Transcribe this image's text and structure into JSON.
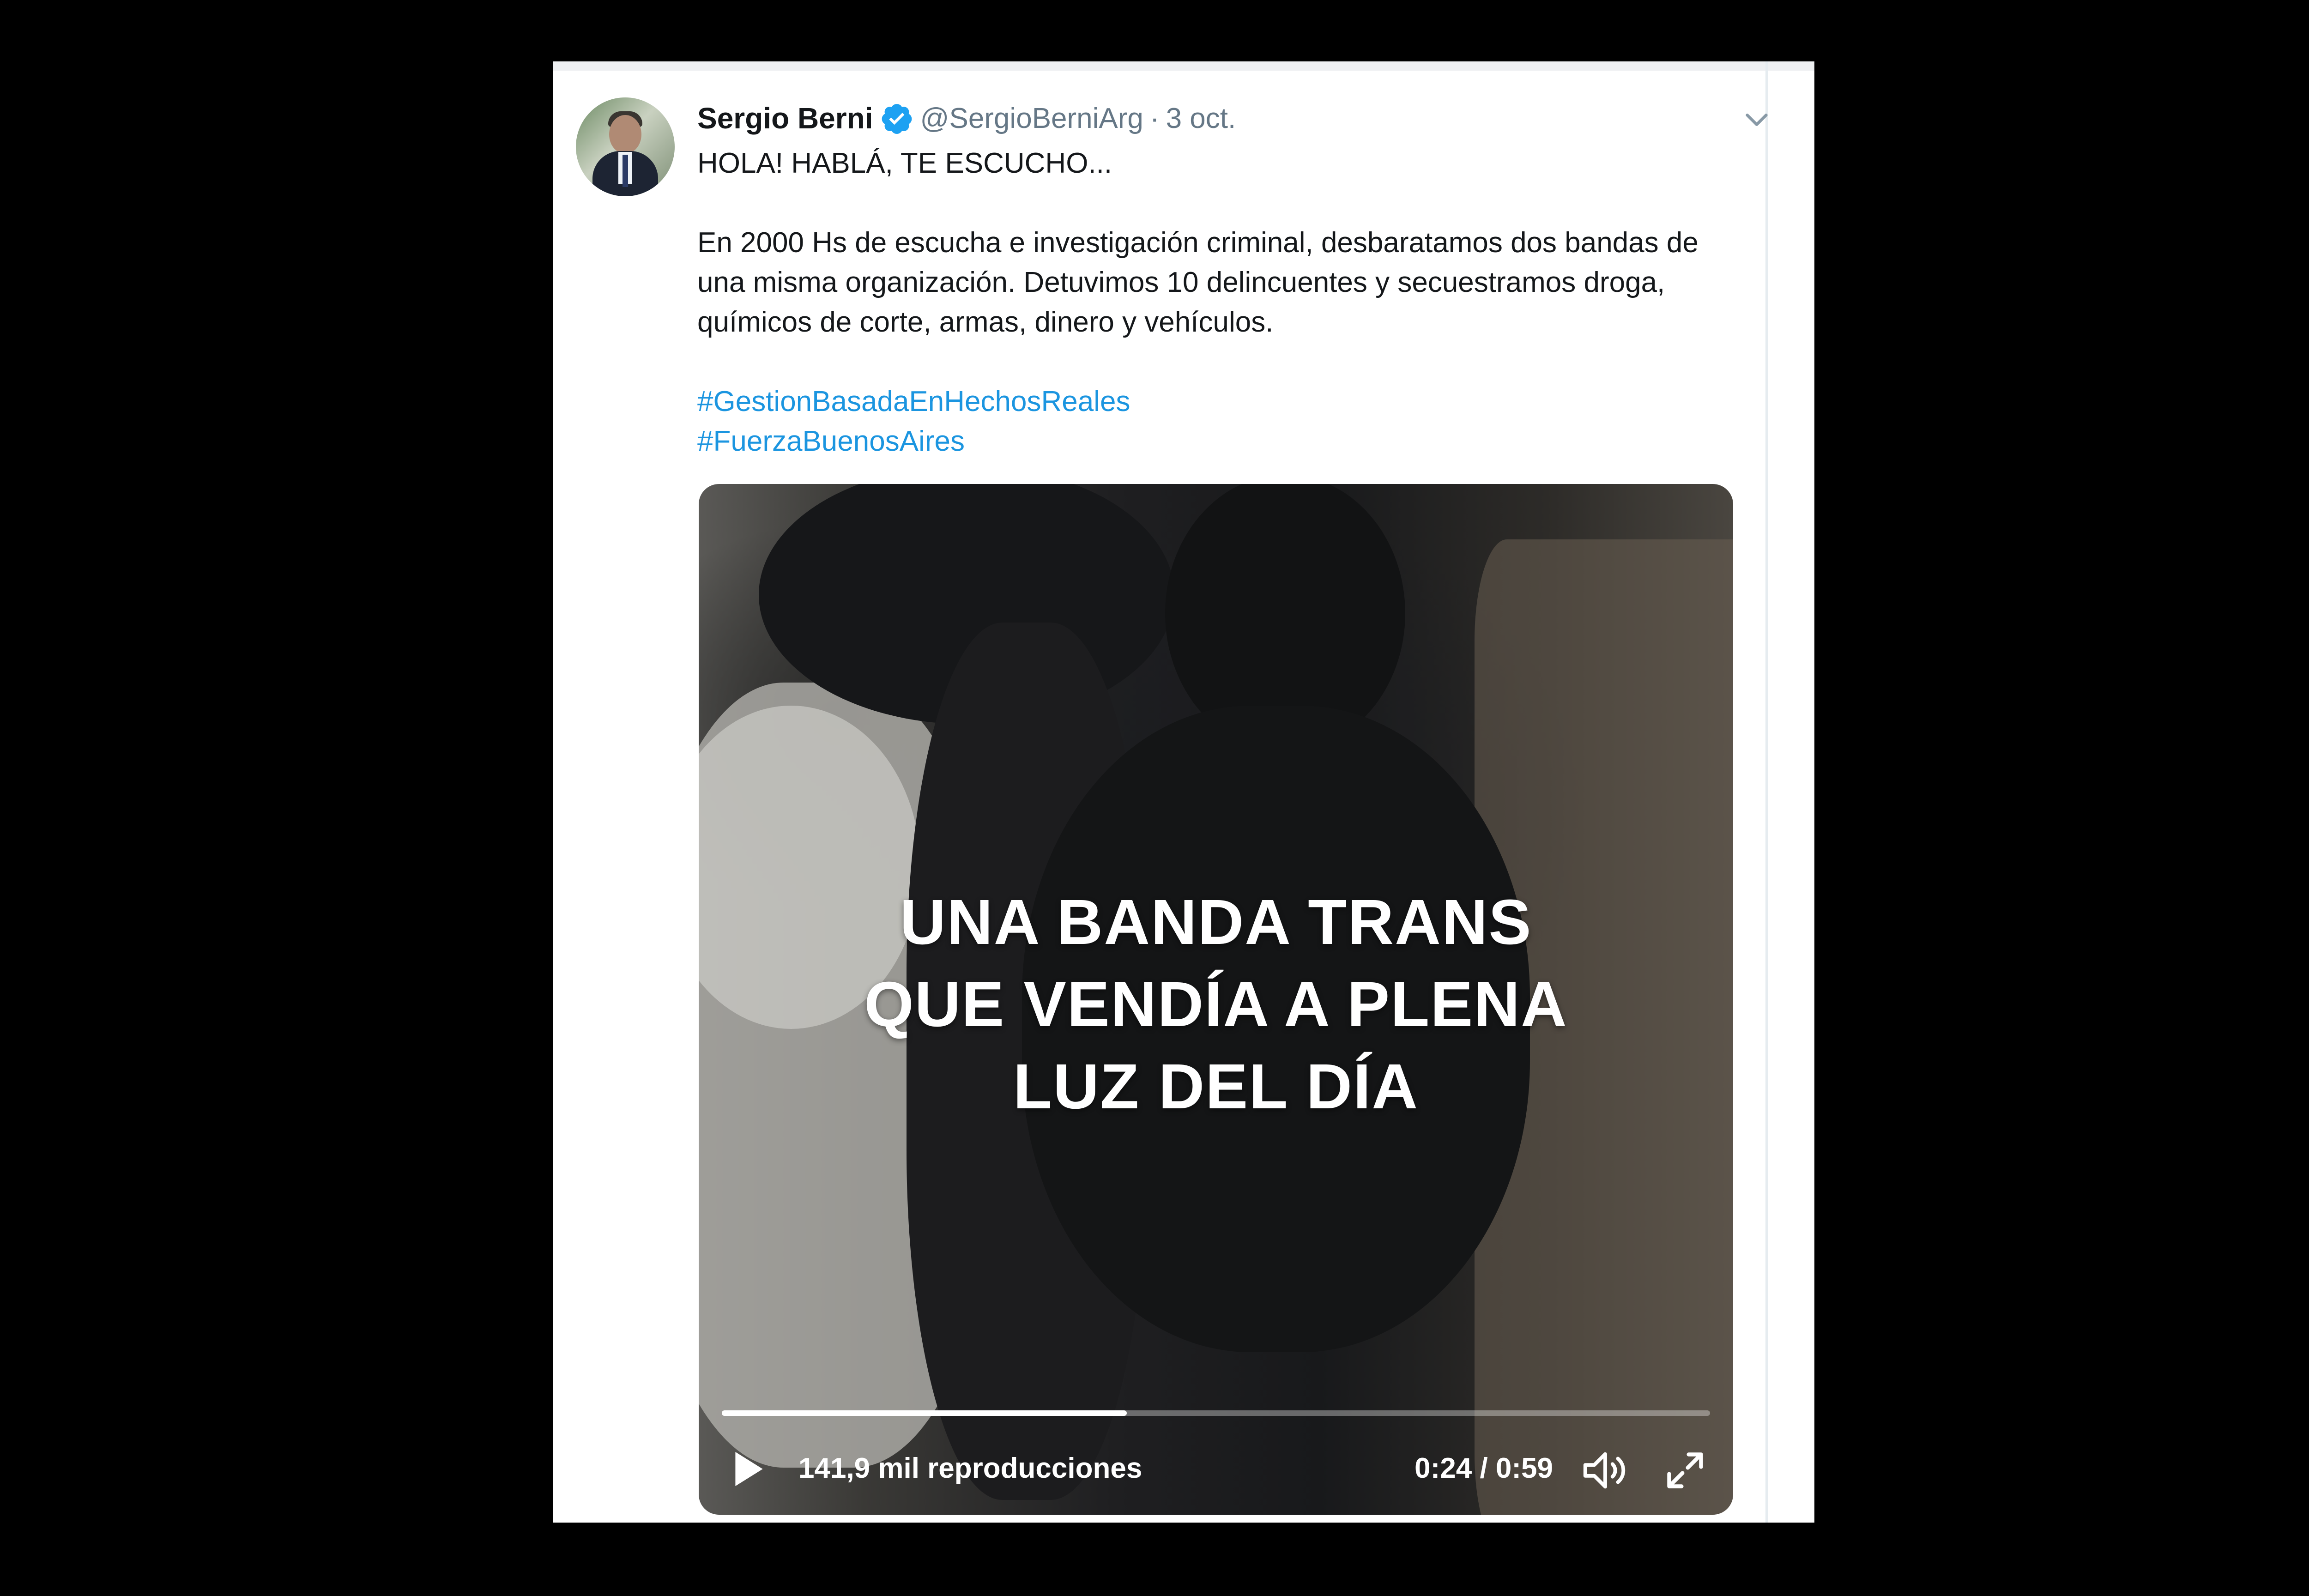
{
  "tweet": {
    "author_name": "Sergio Berni",
    "handle": "@SergioBerniArg",
    "separator": "·",
    "date": "3 oct.",
    "paragraphs": [
      "HOLA! HABLÁ, TE ESCUCHO...",
      "En 2000 Hs de escucha e investigación criminal, desbaratamos dos bandas de una misma organización. Detuvimos 10 delincuentes y secuestramos droga, químicos de corte, armas, dinero y vehículos."
    ],
    "hashtags": [
      "#GestionBasadaEnHechosReales",
      "#FuerzaBuenosAires"
    ],
    "link_color": "#1b95e0",
    "verified_color": "#1da1f2"
  },
  "video": {
    "overlay_lines": [
      "UNA BANDA TRANS",
      "QUE VENDÍA A PLENA",
      "LUZ DEL DÍA"
    ],
    "views": "141,9 mil reproducciones",
    "current_time": "0:24",
    "duration": "0:59",
    "time_display": "0:24 / 0:59",
    "progress_fraction": 0.41
  },
  "icons": {
    "avatar": "avatar",
    "verified": "verified-badge-icon",
    "menu": "chevron-down-icon",
    "play": "play-icon",
    "volume": "volume-icon",
    "fullscreen": "fullscreen-icon"
  }
}
